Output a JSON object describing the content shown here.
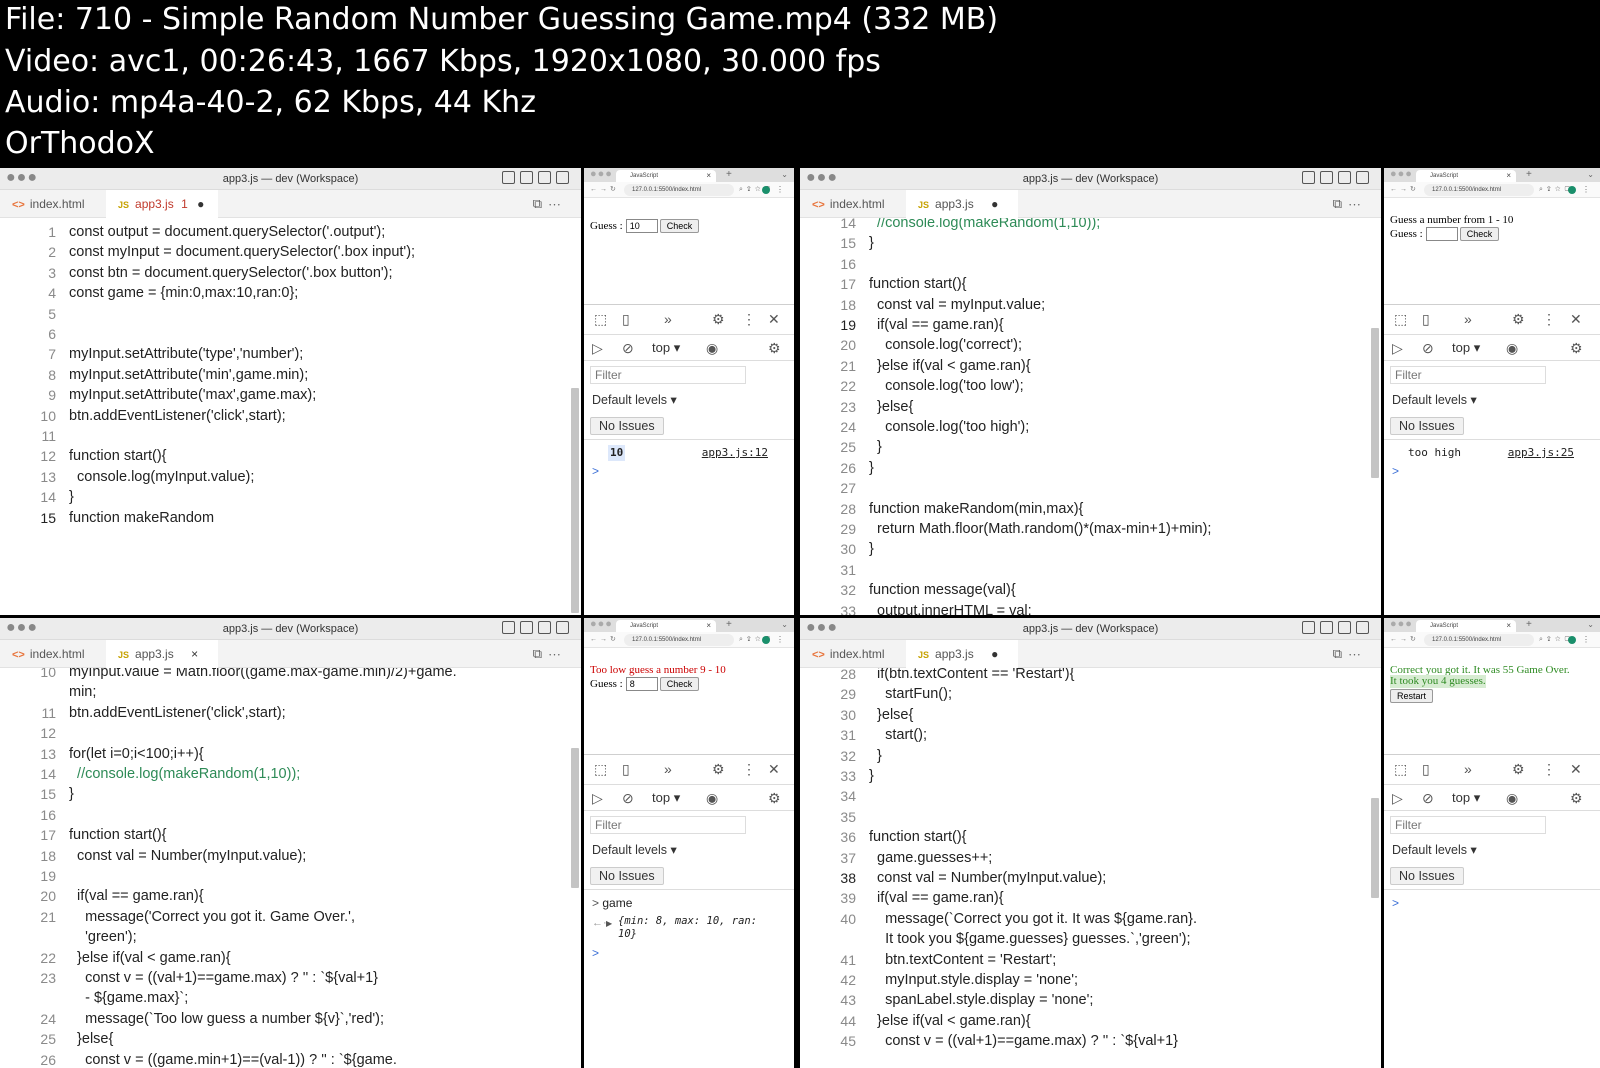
{
  "info": {
    "file": "File: 710 - Simple Random Number Guessing Game.mp4 (332 MB)",
    "video": "Video: avc1, 00:26:43, 1667 Kbps, 1920x1080, 30.000 fps",
    "audio": "Audio: mp4a-40-2, 62 Kbps, 44 Khz",
    "author": "OrThodoX"
  },
  "editors": [
    {
      "title": "app3.js — dev (Workspace)",
      "tabs": [
        {
          "label": "index.html",
          "type": "html",
          "active": false
        },
        {
          "label": "app3.js",
          "type": "js",
          "active": true,
          "badge": "1",
          "state": "●",
          "modified": true
        }
      ],
      "current_line": "15",
      "lines": [
        {
          "n": "1",
          "t": "const output = document.querySelector('.output');"
        },
        {
          "n": "2",
          "t": "const myInput = document.querySelector('.box input');"
        },
        {
          "n": "3",
          "t": "const btn = document.querySelector('.box button');"
        },
        {
          "n": "4",
          "t": "const game = {min:0,max:10,ran:0};"
        },
        {
          "n": "5",
          "t": ""
        },
        {
          "n": "6",
          "t": ""
        },
        {
          "n": "7",
          "t": "myInput.setAttribute('type','number');"
        },
        {
          "n": "8",
          "t": "myInput.setAttribute('min',game.min);"
        },
        {
          "n": "9",
          "t": "myInput.setAttribute('max',game.max);"
        },
        {
          "n": "10",
          "t": "btn.addEventListener('click',start);"
        },
        {
          "n": "11",
          "t": ""
        },
        {
          "n": "12",
          "t": "function start(){"
        },
        {
          "n": "13",
          "t": "  console.log(myInput.value);"
        },
        {
          "n": "14",
          "t": "}"
        },
        {
          "n": "15",
          "t": "function makeRandom"
        }
      ]
    },
    {
      "title": "app3.js — dev (Workspace)",
      "tabs": [
        {
          "label": "index.html",
          "type": "html",
          "active": false
        },
        {
          "label": "app3.js",
          "type": "js",
          "active": true,
          "state": "●"
        }
      ],
      "current_line": "19",
      "lines": [
        {
          "n": "14",
          "t": "  //console.log(makeRandom(1,10));"
        },
        {
          "n": "15",
          "t": "}"
        },
        {
          "n": "16",
          "t": ""
        },
        {
          "n": "17",
          "t": "function start(){"
        },
        {
          "n": "18",
          "t": "  const val = myInput.value;"
        },
        {
          "n": "19",
          "t": "  if(val == game.ran){"
        },
        {
          "n": "20",
          "t": "    console.log('correct');"
        },
        {
          "n": "21",
          "t": "  }else if(val < game.ran){"
        },
        {
          "n": "22",
          "t": "    console.log('too low');"
        },
        {
          "n": "23",
          "t": "  }else{"
        },
        {
          "n": "24",
          "t": "    console.log('too high');"
        },
        {
          "n": "25",
          "t": "  }"
        },
        {
          "n": "26",
          "t": "}"
        },
        {
          "n": "27",
          "t": ""
        },
        {
          "n": "28",
          "t": "function makeRandom(min,max){"
        },
        {
          "n": "29",
          "t": "  return Math.floor(Math.random()*(max-min+1)+min);"
        },
        {
          "n": "30",
          "t": "}"
        },
        {
          "n": "31",
          "t": ""
        },
        {
          "n": "32",
          "t": "function message(val){"
        },
        {
          "n": "33",
          "t": "  output.innerHTML = val;"
        }
      ]
    },
    {
      "title": "app3.js — dev (Workspace)",
      "tabs": [
        {
          "label": "index.html",
          "type": "html",
          "active": false
        },
        {
          "label": "app3.js",
          "type": "js",
          "active": true,
          "state": "×"
        }
      ],
      "current_line": "",
      "lines": [
        {
          "n": "10",
          "t": "myInput.value = Math.floor((game.max-game.min)/2)+game."
        },
        {
          "n": "",
          "t": "min;"
        },
        {
          "n": "11",
          "t": "btn.addEventListener('click',start);"
        },
        {
          "n": "12",
          "t": ""
        },
        {
          "n": "13",
          "t": "for(let i=0;i<100;i++){"
        },
        {
          "n": "14",
          "t": "  //console.log(makeRandom(1,10));"
        },
        {
          "n": "15",
          "t": "}"
        },
        {
          "n": "16",
          "t": ""
        },
        {
          "n": "17",
          "t": "function start(){"
        },
        {
          "n": "18",
          "t": "  const val = Number(myInput.value);"
        },
        {
          "n": "19",
          "t": ""
        },
        {
          "n": "20",
          "t": "  if(val == game.ran){"
        },
        {
          "n": "21",
          "t": "    message('Correct you got it. Game Over.',"
        },
        {
          "n": "",
          "t": "    'green');"
        },
        {
          "n": "22",
          "t": "  }else if(val < game.ran){"
        },
        {
          "n": "23",
          "t": "    const v = ((val+1)==game.max) ? '' : `${val+1}"
        },
        {
          "n": "",
          "t": "    - ${game.max}`;"
        },
        {
          "n": "24",
          "t": "    message(`Too low guess a number ${v}`,'red');"
        },
        {
          "n": "25",
          "t": "  }else{"
        },
        {
          "n": "26",
          "t": "    const v = ((game.min+1)==(val-1)) ? '' : `${game."
        }
      ]
    },
    {
      "title": "app3.js — dev (Workspace)",
      "tabs": [
        {
          "label": "index.html",
          "type": "html",
          "active": false
        },
        {
          "label": "app3.js",
          "type": "js",
          "active": true,
          "state": "●"
        }
      ],
      "current_line": "38",
      "lines": [
        {
          "n": "28",
          "t": "  if(btn.textContent == 'Restart'){"
        },
        {
          "n": "29",
          "t": "    startFun();"
        },
        {
          "n": "30",
          "t": "  }else{"
        },
        {
          "n": "31",
          "t": "    start();"
        },
        {
          "n": "32",
          "t": "  }"
        },
        {
          "n": "33",
          "t": "}"
        },
        {
          "n": "34",
          "t": ""
        },
        {
          "n": "35",
          "t": ""
        },
        {
          "n": "36",
          "t": "function start(){"
        },
        {
          "n": "37",
          "t": "  game.guesses++;"
        },
        {
          "n": "38",
          "t": "  const val = Number(myInput.value);"
        },
        {
          "n": "39",
          "t": "  if(val == game.ran){"
        },
        {
          "n": "40",
          "t": "    message(`Correct you got it. It was ${game.ran}."
        },
        {
          "n": "",
          "t": "    It took you ${game.guesses} guesses.`,'green');"
        },
        {
          "n": "41",
          "t": "    btn.textContent = 'Restart';"
        },
        {
          "n": "42",
          "t": "    myInput.style.display = 'none';"
        },
        {
          "n": "43",
          "t": "    spanLabel.style.display = 'none';"
        },
        {
          "n": "44",
          "t": "  }else if(val < game.ran){"
        },
        {
          "n": "45",
          "t": "    const v = ((val+1)==game.max) ? '' : `${val+1}"
        }
      ]
    }
  ],
  "browsers": [
    {
      "tab": "JavaScript",
      "url": "127.0.0.1:5500/index.html",
      "guess_label": "Guess :",
      "guess_value": "10",
      "check_label": "Check",
      "devtools": {
        "top": "top",
        "filter": "Filter",
        "levels": "Default levels",
        "no_issues": "No Issues",
        "console_text": "10",
        "source": "app3.js:12",
        "prompt": ">"
      }
    },
    {
      "tab": "JavaScript",
      "url": "127.0.0.1:5500/index.html",
      "heading": "Guess a number from 1 - 10",
      "guess_label": "Guess :",
      "guess_value": "",
      "check_label": "Check",
      "devtools": {
        "top": "top",
        "filter": "Filter",
        "levels": "Default levels",
        "no_issues": "No Issues",
        "console_text": "too high",
        "source": "app3.js:25",
        "prompt": ">"
      }
    },
    {
      "tab": "JavaScript",
      "url": "127.0.0.1:5500/index.html",
      "heading": "Too low guess a number 9 - 10",
      "heading_color": "#cc0000",
      "guess_label": "Guess :",
      "guess_value": "8",
      "check_label": "Check",
      "devtools": {
        "top": "top",
        "filter": "Filter",
        "levels": "Default levels",
        "no_issues": "No Issues",
        "console_input": "game",
        "object_preview": "{min: 8, max: 10, ran: 10}",
        "prompt": ">"
      }
    },
    {
      "tab": "JavaScript",
      "url": "127.0.0.1:5500/index.html",
      "heading": "Correct you got it. It was 55 Game Over.",
      "heading2": "It took you 4 guesses.",
      "heading_color": "#2e8b22",
      "restart_label": "Restart",
      "devtools": {
        "top": "top",
        "filter": "Filter",
        "levels": "Default levels",
        "no_issues": "No Issues",
        "prompt": ">"
      }
    }
  ]
}
